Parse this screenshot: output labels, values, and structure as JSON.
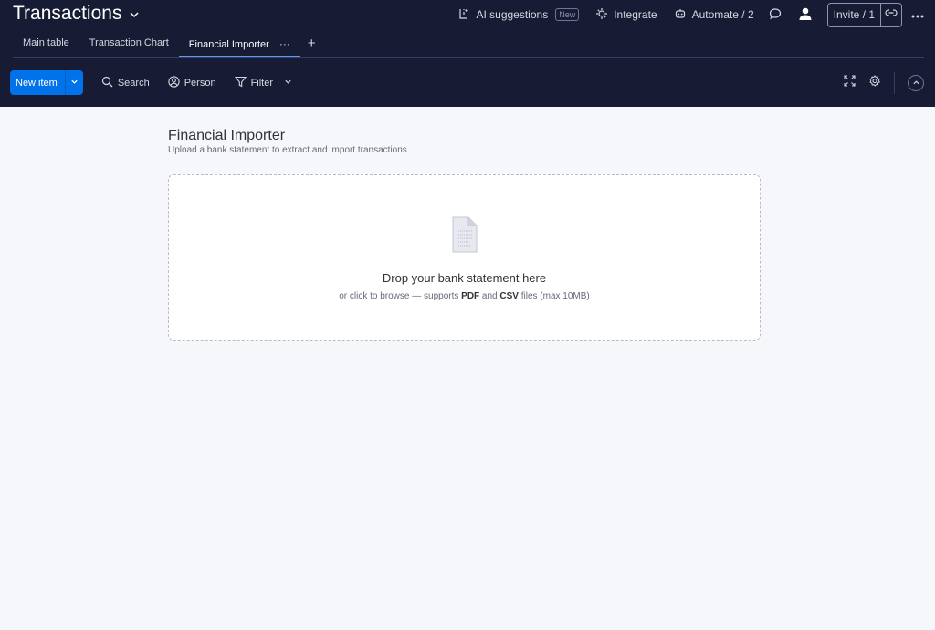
{
  "header": {
    "title": "Transactions",
    "actions": {
      "ai_label": "AI suggestions",
      "ai_badge": "New",
      "integrate_label": "Integrate",
      "automate_label": "Automate / 2",
      "invite_label": "Invite / 1"
    },
    "tabs": [
      {
        "label": "Main table"
      },
      {
        "label": "Transaction Chart"
      },
      {
        "label": "Financial Importer",
        "more": "···"
      }
    ],
    "add_tab": "+"
  },
  "toolbar": {
    "new_item_label": "New item",
    "search_label": "Search",
    "person_label": "Person",
    "filter_label": "Filter"
  },
  "importer": {
    "title": "Financial Importer",
    "subtitle": "Upload a bank statement to extract and import transactions",
    "drop_title": "Drop your bank statement here",
    "drop_desc_prefix": "or click to browse — supports ",
    "format_pdf": "PDF",
    "drop_desc_and": " and ",
    "format_csv": "CSV",
    "drop_desc_suffix": " files (max 10MB)"
  },
  "icons": {
    "title_chevron": "chevron-down-icon",
    "ai": "ai-suggestions-icon",
    "integrate": "integrate-icon",
    "automate": "robot-icon",
    "updates": "chat-bubble-icon",
    "user": "user-avatar-icon",
    "link": "link-icon",
    "more": "more-dots-icon",
    "search": "search-icon",
    "person": "person-icon",
    "filter": "filter-icon",
    "expand": "expand-icon",
    "settings": "gear-icon",
    "collapse": "chevron-up-icon",
    "file": "file-icon"
  },
  "colors": {
    "header_bg": "#181b34",
    "accent": "#0073ea",
    "active_tab_underline": "#579bfc",
    "page_bg": "#f6f7fb"
  }
}
